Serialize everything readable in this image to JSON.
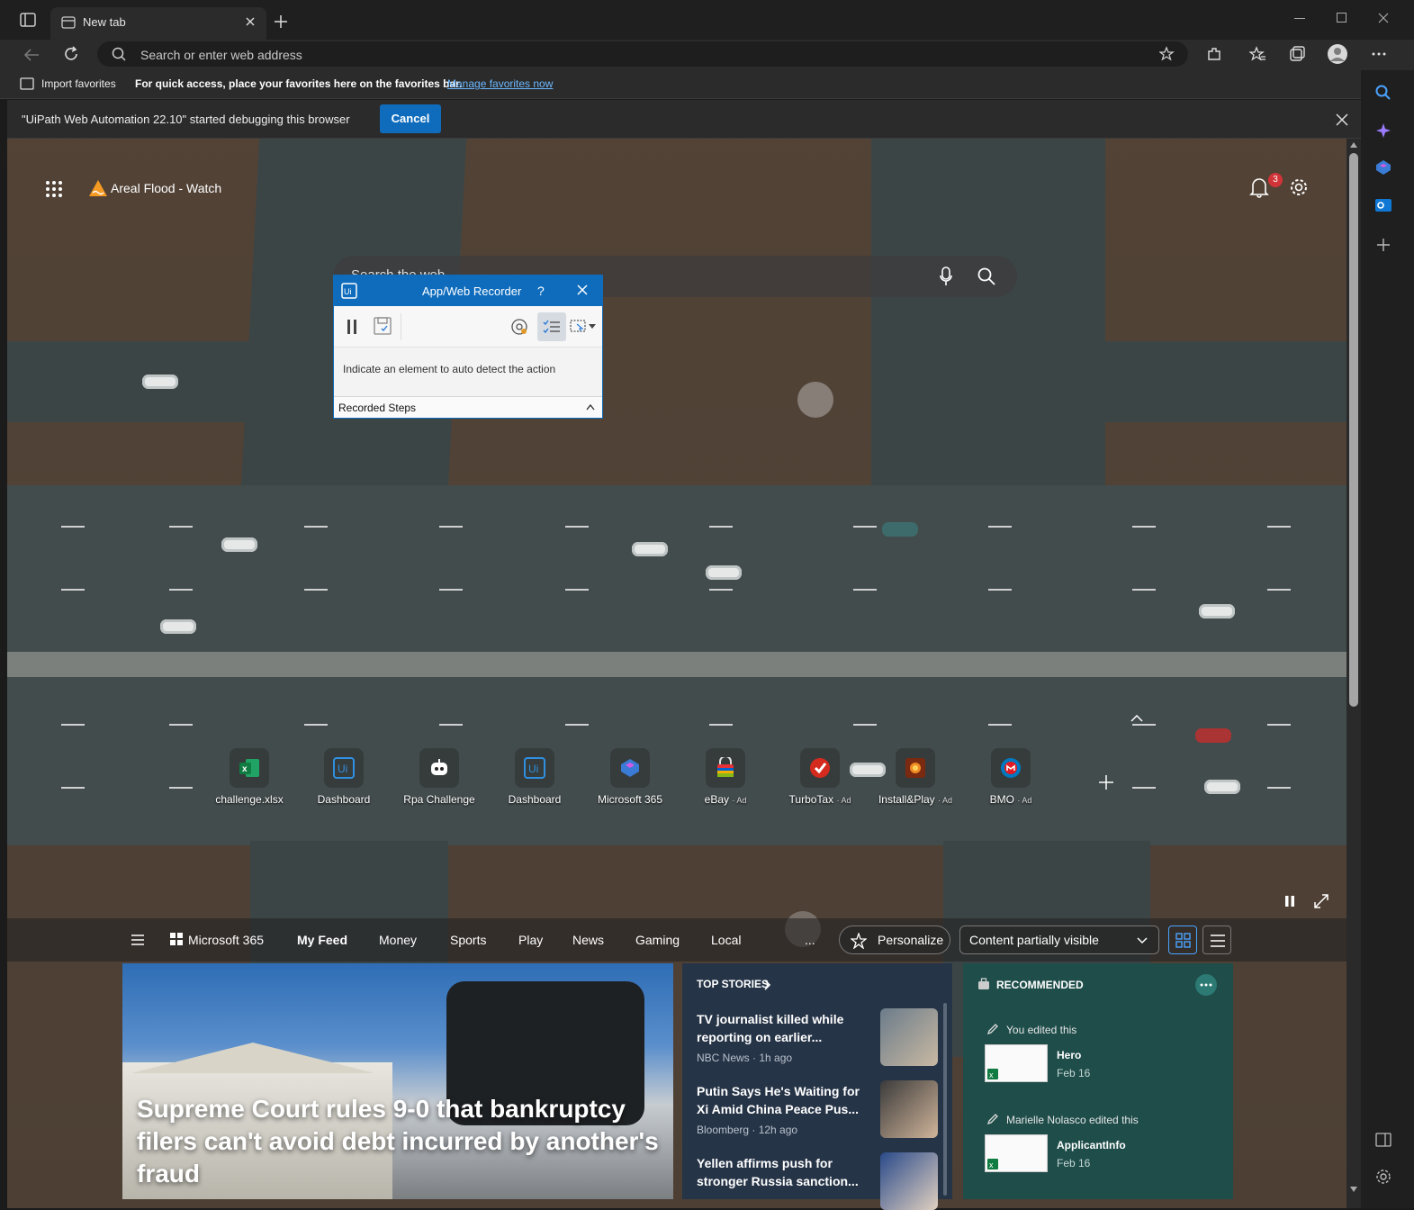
{
  "browser": {
    "tab_title": "New tab",
    "address_placeholder": "Search or enter web address",
    "favorites_bar": {
      "import_label": "Import favorites",
      "hint": "For quick access, place your favorites here on the favorites bar.",
      "manage_link": "Manage favorites now"
    },
    "infobar": {
      "message": "\"UiPath Web Automation 22.10\" started debugging this browser",
      "cancel_label": "Cancel"
    }
  },
  "newtab": {
    "weather_alert": "Areal Flood - Watch",
    "notification_count": "3",
    "search_placeholder": "Search the web",
    "quick_links": [
      {
        "label": "challenge.xlsx",
        "ad": "",
        "icon": "excel-icon"
      },
      {
        "label": "Dashboard",
        "ad": "",
        "icon": "uipath-icon"
      },
      {
        "label": "Rpa Challenge",
        "ad": "",
        "icon": "robot-icon"
      },
      {
        "label": "Dashboard",
        "ad": "",
        "icon": "uipath-icon"
      },
      {
        "label": "Microsoft 365",
        "ad": "",
        "icon": "m365-icon"
      },
      {
        "label": "eBay",
        "ad": "· Ad",
        "icon": "ebay-icon"
      },
      {
        "label": "TurboTax",
        "ad": "· Ad",
        "icon": "turbotax-icon"
      },
      {
        "label": "Install&Play",
        "ad": "· Ad",
        "icon": "game-icon"
      },
      {
        "label": "BMO",
        "ad": "· Ad",
        "icon": "bmo-icon"
      }
    ],
    "feed_nav": {
      "m365": "Microsoft 365",
      "items": [
        "My Feed",
        "Money",
        "Sports",
        "Play",
        "News",
        "Gaming",
        "Local"
      ],
      "more": "...",
      "personalize": "Personalize",
      "content_visibility": "Content partially visible"
    },
    "hero": {
      "title": "Supreme Court rules 9-0 that bankruptcy filers can't avoid debt incurred by another's fraud"
    },
    "top_stories": {
      "heading": "TOP STORIES",
      "stories": [
        {
          "title": "TV journalist killed while reporting on earlier...",
          "source": "NBC News · 1h ago"
        },
        {
          "title": "Putin Says He's Waiting for Xi Amid China Peace Pus...",
          "source": "Bloomberg · 12h ago"
        },
        {
          "title": "Yellen affirms push for stronger Russia sanction...",
          "source": ""
        }
      ]
    },
    "recommended": {
      "heading": "RECOMMENDED",
      "items": [
        {
          "who": "You edited this",
          "name": "Hero",
          "date": "Feb 16"
        },
        {
          "who": "Marielle Nolasco edited this",
          "name": "ApplicantInfo",
          "date": "Feb 16"
        }
      ]
    }
  },
  "recorder": {
    "title": "App/Web Recorder",
    "help": "?",
    "instruction": "Indicate an element to auto detect the action",
    "recorded_steps": "Recorded Steps"
  },
  "colors": {
    "accent": "#0f6cbd",
    "notification_badge": "#d13438",
    "recommended_bg": "#1e4d4a",
    "top_stories_bg": "#263447"
  }
}
